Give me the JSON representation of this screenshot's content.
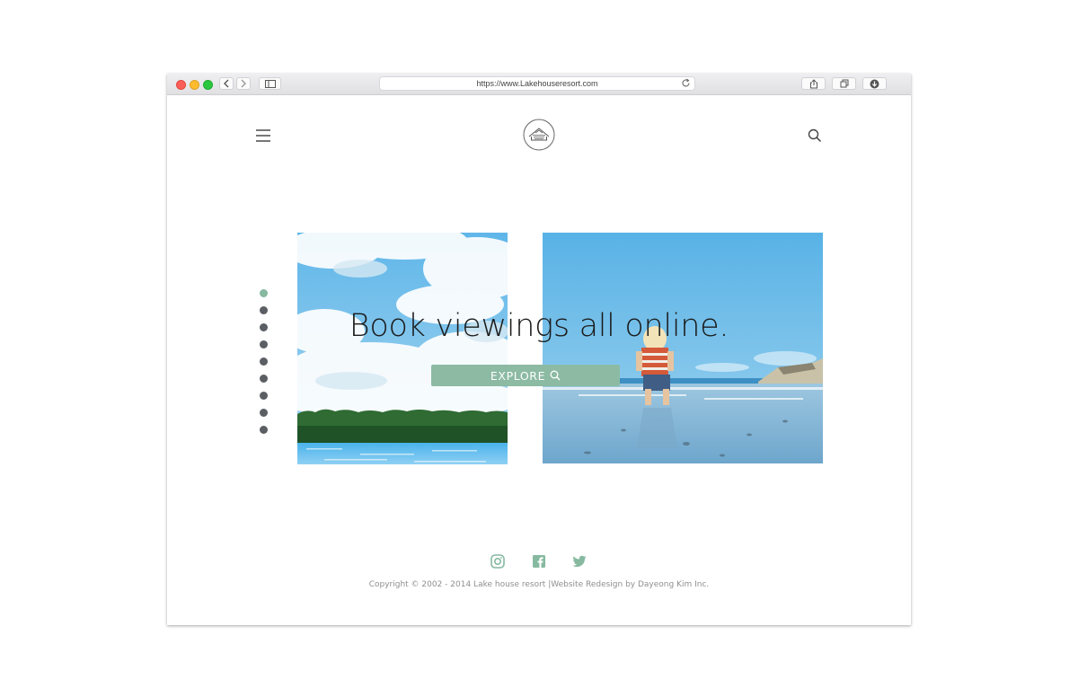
{
  "browser": {
    "url": "https://www.Lakehouseresort.com",
    "traffic_light_colors": [
      "#fc5f57",
      "#fdbb2e",
      "#2ac83f"
    ],
    "icons": [
      "back-icon",
      "forward-icon",
      "sidebar-icon",
      "reload-icon",
      "share-icon",
      "tabs-icon",
      "download-icon"
    ]
  },
  "header": {
    "menu_icon": "hamburger-icon",
    "logo_icon": "lake-house-logo",
    "search_icon": "search-icon"
  },
  "hero": {
    "headline": "Book viewings all online.",
    "cta_label": "EXPLORE",
    "cta_icon": "search-icon",
    "cta_color": "#8cbaa3",
    "slides_count": 9,
    "active_slide": 1,
    "active_dot_color": "#86b9a0",
    "images": [
      "lake-sky-trees-photo",
      "child-on-beach-photo"
    ]
  },
  "footer": {
    "social_icons": [
      "instagram-icon",
      "facebook-icon",
      "twitter-icon"
    ],
    "social_color": "#86b9a0",
    "copyright": "Copyright © 2002 - 2014 Lake house resort |Website Redesign by Dayeong Kim Inc."
  }
}
